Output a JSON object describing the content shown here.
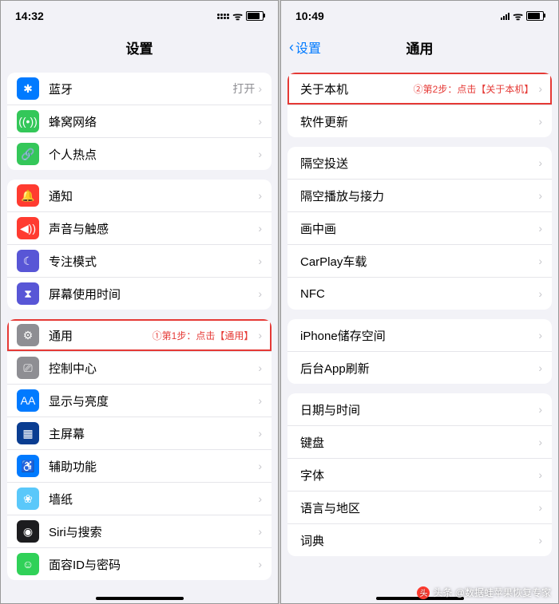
{
  "left": {
    "status": {
      "time": "14:32"
    },
    "title": "设置",
    "groups": [
      {
        "rows": [
          {
            "icon": "bluetooth-icon",
            "iconColor": "c-blue",
            "glyph": "✱",
            "label": "蓝牙",
            "value": "打开"
          },
          {
            "icon": "cellular-icon",
            "iconColor": "c-green",
            "glyph": "((•))",
            "label": "蜂窝网络"
          },
          {
            "icon": "hotspot-icon",
            "iconColor": "c-green",
            "glyph": "🔗",
            "label": "个人热点"
          }
        ]
      },
      {
        "rows": [
          {
            "icon": "notifications-icon",
            "iconColor": "c-red",
            "glyph": "🔔",
            "label": "通知"
          },
          {
            "icon": "sounds-icon",
            "iconColor": "c-red",
            "glyph": "◀))",
            "label": "声音与触感"
          },
          {
            "icon": "focus-icon",
            "iconColor": "c-purple",
            "glyph": "☾",
            "label": "专注模式"
          },
          {
            "icon": "screentime-icon",
            "iconColor": "c-purple",
            "glyph": "⧗",
            "label": "屏幕使用时间"
          }
        ]
      },
      {
        "rows": [
          {
            "icon": "general-icon",
            "iconColor": "c-gray",
            "glyph": "⚙",
            "label": "通用",
            "annotation": "①第1步：点击【通用】",
            "highlight": true
          },
          {
            "icon": "control-center-icon",
            "iconColor": "c-gray",
            "glyph": "⎚",
            "label": "控制中心"
          },
          {
            "icon": "display-icon",
            "iconColor": "c-blue",
            "glyph": "AA",
            "label": "显示与亮度"
          },
          {
            "icon": "homescreen-icon",
            "iconColor": "c-darkblue",
            "glyph": "▦",
            "label": "主屏幕"
          },
          {
            "icon": "accessibility-icon",
            "iconColor": "c-blue",
            "glyph": "♿",
            "label": "辅助功能"
          },
          {
            "icon": "wallpaper-icon",
            "iconColor": "c-teal",
            "glyph": "❀",
            "label": "墙纸"
          },
          {
            "icon": "siri-icon",
            "iconColor": "c-black",
            "glyph": "◉",
            "label": "Siri与搜索"
          },
          {
            "icon": "faceid-icon",
            "iconColor": "c-green2",
            "glyph": "☺",
            "label": "面容ID与密码"
          }
        ]
      }
    ]
  },
  "right": {
    "status": {
      "time": "10:49"
    },
    "back": "设置",
    "title": "通用",
    "groups": [
      {
        "rows": [
          {
            "label": "关于本机",
            "annotation": "②第2步：点击【关于本机】",
            "highlight": true
          },
          {
            "label": "软件更新"
          }
        ]
      },
      {
        "rows": [
          {
            "label": "隔空投送"
          },
          {
            "label": "隔空播放与接力"
          },
          {
            "label": "画中画"
          },
          {
            "label": "CarPlay车载"
          },
          {
            "label": "NFC"
          }
        ]
      },
      {
        "rows": [
          {
            "label": "iPhone储存空间"
          },
          {
            "label": "后台App刷新"
          }
        ]
      },
      {
        "rows": [
          {
            "label": "日期与时间"
          },
          {
            "label": "键盘"
          },
          {
            "label": "字体"
          },
          {
            "label": "语言与地区"
          },
          {
            "label": "词典"
          }
        ]
      }
    ]
  },
  "watermark": "头条 @数据蛙苹果恢复专家"
}
